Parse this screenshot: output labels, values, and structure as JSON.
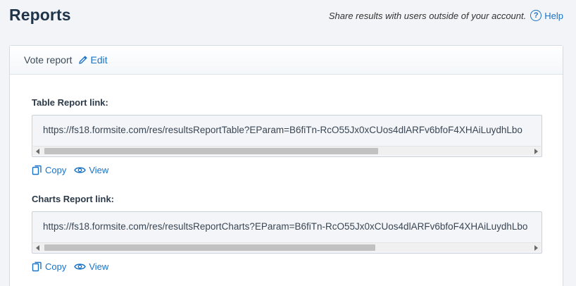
{
  "header": {
    "title": "Reports",
    "share_text": "Share results with users outside of your account.",
    "help_label": "Help"
  },
  "card": {
    "report_name": "Vote report",
    "edit_label": "Edit"
  },
  "links": [
    {
      "label": "Table Report link:",
      "url": "https://fs18.formsite.com/res/resultsReportTable?EParam=B6fiTn-RcO55Jx0xCUos4dlARFv6bfoF4XHAiLuydhLbo",
      "copy_label": "Copy",
      "view_label": "View"
    },
    {
      "label": "Charts Report link:",
      "url": "https://fs18.formsite.com/res/resultsReportCharts?EParam=B6fiTn-RcO55Jx0xCUos4dlARFv6bfoF4XHAiLuydhLbo",
      "copy_label": "Copy",
      "view_label": "View"
    }
  ],
  "icons": {
    "help": "help-circle-icon",
    "edit": "pencil-icon",
    "copy": "copy-icon",
    "view": "eye-icon"
  },
  "colors": {
    "accent": "#1a73c7",
    "title": "#1f3349",
    "background": "#f2f4f7"
  }
}
